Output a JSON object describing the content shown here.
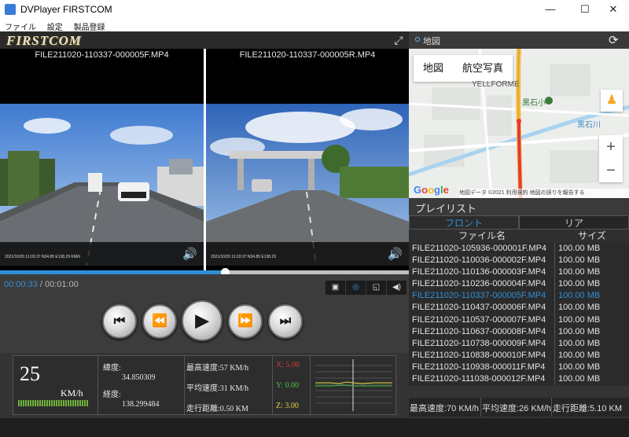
{
  "window": {
    "title": "DVPlayer FIRSTCOM",
    "minimize": "—",
    "maximize": "☐",
    "close": "✕"
  },
  "menu": [
    "ファイル",
    "設定",
    "製品登録"
  ],
  "brand": {
    "logo": "FIRSTCOM",
    "expand_icon": "expand-icon"
  },
  "videos": {
    "front": {
      "filename": "FILE211020-110337-000005F.MP4",
      "overlay": "2021/10/20 11:03:37 N34.85 E138.29 KM/h"
    },
    "rear": {
      "filename": "FILE211020-110337-000005R.MP4",
      "overlay": "2021/10/20 11:03:37 N34.85 E138.29"
    }
  },
  "playback": {
    "current": "00:00:33",
    "separator": " / ",
    "total": "00:01:00",
    "progress_fraction": 0.55
  },
  "controls": {
    "prev": "⏮",
    "rewind": "⏪",
    "play": "▶",
    "forward": "⏩",
    "next": "⏭"
  },
  "info": {
    "speed": "25",
    "speed_unit": "KM/h",
    "lat_label": "緯度:",
    "lat": "34.850309",
    "lon_label": "経度:",
    "lon": "138.299484",
    "max_speed": "最高速度:57 KM/h",
    "avg_speed": "平均速度:31 KM/h",
    "distance": "走行距離:0.50 KM",
    "gx": "X: 5.00",
    "gy": "Y: 0.00",
    "gz": "Z: 3.00"
  },
  "map": {
    "header": "地図",
    "tab_map": "地図",
    "tab_satellite": "航空写真",
    "label_store": "YELLFORME",
    "label_school": "黒石小",
    "label_river": "黒石川",
    "google": "Google",
    "attribution": "地図データ ©2021   利用規約   地図の誤りを報告する",
    "zoom_in": "+",
    "zoom_out": "−"
  },
  "playlist": {
    "title": "プレイリスト",
    "tab_front": "フロント",
    "tab_rear": "リア",
    "col_name": "ファイル名",
    "col_size": "サイズ",
    "files": [
      {
        "name": "FILE211020-105936-000001F.MP4",
        "size": "100.00 MB"
      },
      {
        "name": "FILE211020-110036-000002F.MP4",
        "size": "100.00 MB"
      },
      {
        "name": "FILE211020-110136-000003F.MP4",
        "size": "100.00 MB"
      },
      {
        "name": "FILE211020-110236-000004F.MP4",
        "size": "100.00 MB"
      },
      {
        "name": "FILE211020-110337-000005F.MP4",
        "size": "100.00 MB"
      },
      {
        "name": "FILE211020-110437-000006F.MP4",
        "size": "100.00 MB"
      },
      {
        "name": "FILE211020-110537-000007F.MP4",
        "size": "100.00 MB"
      },
      {
        "name": "FILE211020-110637-000008F.MP4",
        "size": "100.00 MB"
      },
      {
        "name": "FILE211020-110738-000009F.MP4",
        "size": "100.00 MB"
      },
      {
        "name": "FILE211020-110838-000010F.MP4",
        "size": "100.00 MB"
      },
      {
        "name": "FILE211020-110938-000011F.MP4",
        "size": "100.00 MB"
      },
      {
        "name": "FILE211020-111038-000012F.MP4",
        "size": "100.00 MB"
      }
    ],
    "selected_index": 4,
    "stat_max": "最高速度:70 KM/h",
    "stat_avg": "平均速度:26 KM/h",
    "stat_dist": "走行距離:5.10 KM"
  },
  "colors": {
    "accent": "#2f8fd6",
    "gx": "#d63a3a",
    "gy": "#45c445",
    "gz": "#e6d43a"
  }
}
